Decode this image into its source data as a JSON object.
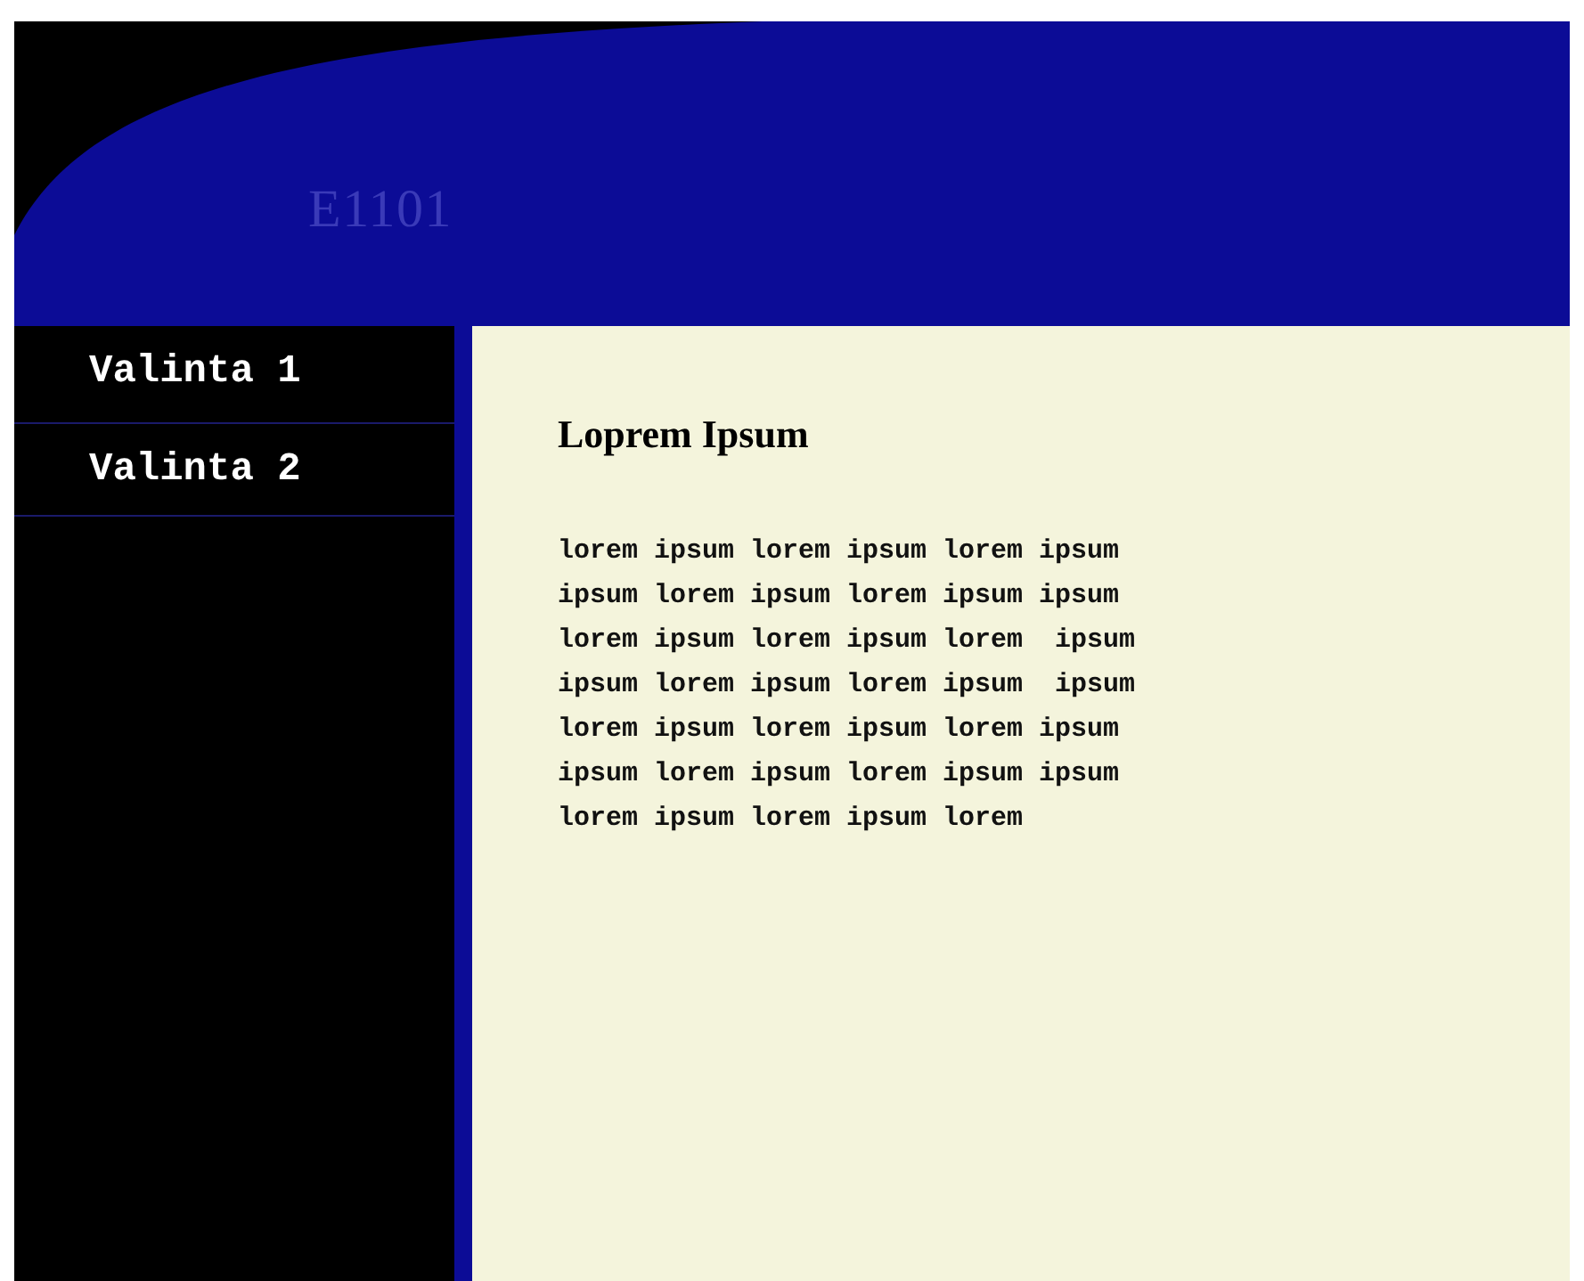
{
  "header": {
    "title": "E1101"
  },
  "sidebar": {
    "items": [
      {
        "label": "Valinta 1"
      },
      {
        "label": "Valinta 2"
      }
    ]
  },
  "content": {
    "heading": "Loprem Ipsum",
    "lines": [
      "lorem ipsum lorem ipsum lorem ipsum",
      "ipsum lorem ipsum lorem ipsum ipsum",
      "lorem ipsum lorem ipsum lorem  ipsum",
      "ipsum lorem ipsum lorem ipsum  ipsum",
      "lorem ipsum lorem ipsum lorem ipsum",
      "ipsum lorem ipsum lorem ipsum ipsum",
      "lorem ipsum lorem ipsum lorem"
    ]
  }
}
